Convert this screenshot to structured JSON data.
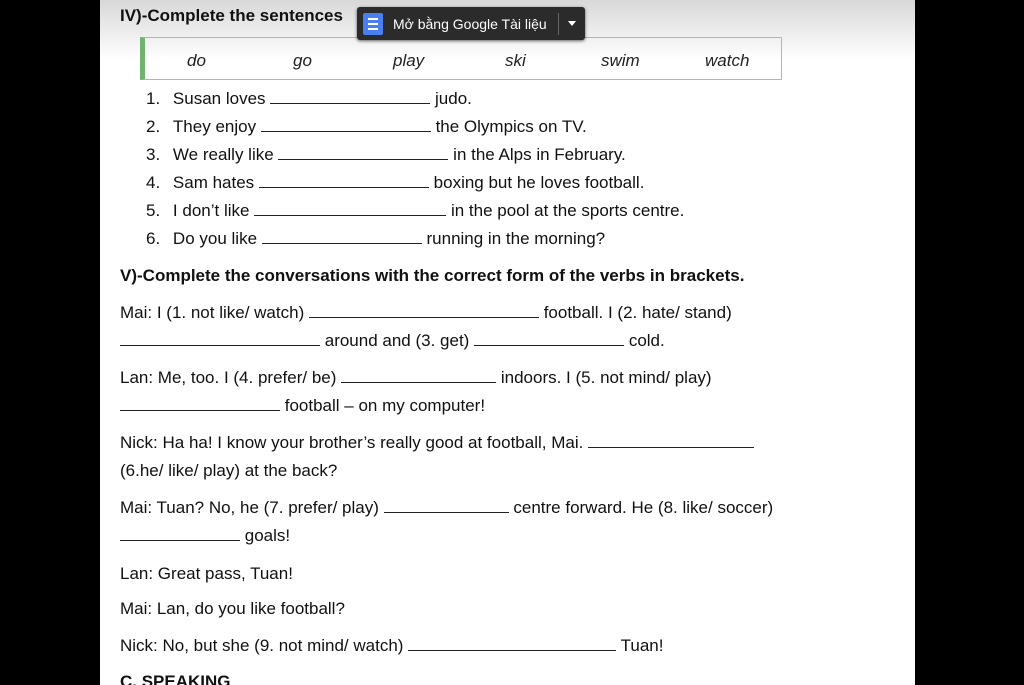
{
  "toolbar": {
    "label": "Mở bằng Google Tài liệu"
  },
  "section4": {
    "heading": "IV)-Complete the sentences",
    "words": [
      "do",
      "go",
      "play",
      "ski",
      "swim",
      "watch"
    ],
    "sentences": [
      {
        "num": "1.",
        "before": "Susan loves",
        "after": "judo."
      },
      {
        "num": "2.",
        "before": "They enjoy",
        "after": "the Olympics on TV."
      },
      {
        "num": "3.",
        "before": "We really like",
        "after": "in the Alps in February."
      },
      {
        "num": "4.",
        "before": "Sam hates",
        "after": "boxing but he loves football."
      },
      {
        "num": "5.",
        "before": "I don’t like",
        "after": "in the pool at the sports centre."
      },
      {
        "num": "6.",
        "before": "Do you like",
        "after": "running in the morning?"
      }
    ]
  },
  "section5": {
    "heading": "V)-Complete the conversations with the correct form of the verbs in brackets.",
    "lines": {
      "l1a": "Mai: I (1. not like/ watch)",
      "l1b": "football. I (2. hate/ stand)",
      "l2a": "around and (3. get)",
      "l2b": "cold.",
      "l3a": "Lan: Me, too. I (4. prefer/ be)",
      "l3b": "indoors. I (5. not mind/ play)",
      "l4a": "football – on my computer!",
      "l5a": "Nick: Ha ha! I know your brother’s really good at football, Mai.",
      "l6a": "(6.he/ like/ play) at the back?",
      "l7a": "Mai: Tuan? No, he (7. prefer/ play)",
      "l7b": "centre forward. He (8. like/ soccer)",
      "l8a": "goals!",
      "l9a": "Lan: Great pass, Tuan!",
      "l10a": "Mai: Lan, do you like football?",
      "l11a": "Nick: No, but she (9. not mind/ watch)",
      "l11b": "Tuan!"
    }
  },
  "section_c": {
    "heading": "C. SPEAKING"
  }
}
